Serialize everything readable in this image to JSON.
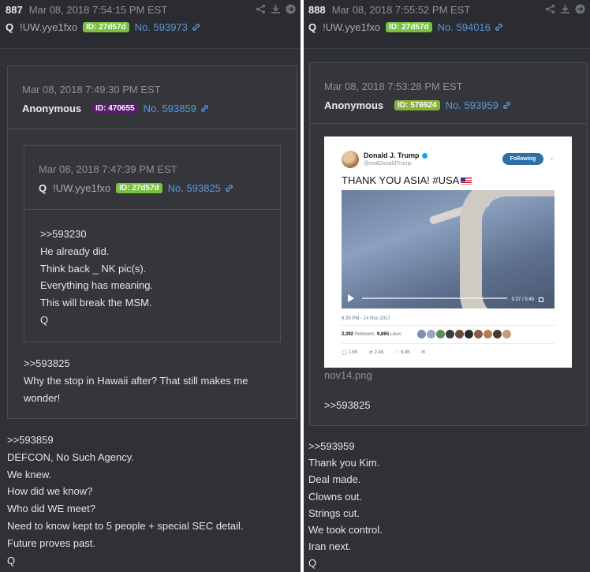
{
  "left": {
    "post_num": "887",
    "date": "Mar 08, 2018 7:54:15 PM EST",
    "author": "Q",
    "trip": "!UW.yye1fxo",
    "id_badge": "ID: 27d57d",
    "post_no": "No. 593973",
    "quote": {
      "date": "Mar 08, 2018 7:49:30 PM EST",
      "author": "Anonymous",
      "id_badge": "ID: 470655",
      "post_no": "No. 593859",
      "inner": {
        "date": "Mar 08, 2018 7:47:39 PM EST",
        "author": "Q",
        "trip": "!UW.yye1fxo",
        "id_badge": "ID: 27d57d",
        "post_no": "No. 593825",
        "lines": [
          ">>593230",
          "He already did.",
          "Think back _ NK pic(s).",
          "Everything has meaning.",
          "This will break the MSM.",
          "Q"
        ]
      },
      "lines": [
        ">>593825",
        "Why the stop in Hawaii after? That still makes me wonder!"
      ]
    },
    "lines": [
      ">>593859",
      "DEFCON, No Such Agency.",
      "We knew.",
      "How did we know?",
      "Who did WE meet?",
      "Need to know kept to 5 people + special SEC detail.",
      "Future proves past.",
      "Q"
    ]
  },
  "right": {
    "post_num": "888",
    "date": "Mar 08, 2018 7:55:52 PM EST",
    "author": "Q",
    "trip": "!UW.yye1fxo",
    "id_badge": "ID: 27d57d",
    "post_no": "No. 594016",
    "quote": {
      "date": "Mar 08, 2018 7:53:28 PM EST",
      "author": "Anonymous",
      "id_badge": "ID: 576924",
      "post_no": "No. 593959",
      "image_caption": "nov14.png",
      "tweet": {
        "name": "Donald J. Trump",
        "handle": "@realDonaldTrump",
        "follow_label": "Following",
        "text": "THANK YOU ASIA! #USA",
        "video_time": "0:37 / 0:45",
        "timestamp": "6:39 PM - 14 Nov 2017",
        "retweets": "2,392",
        "retweets_label": "Retweets",
        "likes": "9,865",
        "likes_label": "Likes",
        "replies_count": "1.8K",
        "rt_count": "2.4K",
        "like_count": "9.9K"
      },
      "lines": [
        ">>593825"
      ]
    },
    "lines": [
      ">>593959",
      "Thank you Kim.",
      "Deal made.",
      "Clowns out.",
      "Strings cut.",
      "We took control.",
      "Iran next.",
      "Q"
    ]
  },
  "colors": {
    "background": "#2f3136",
    "link": "#5c96d8",
    "id_green": "#79c142",
    "id_purple": "#5a1f6a"
  },
  "icons": [
    "share-icon",
    "download-icon",
    "go-icon",
    "link-icon"
  ]
}
